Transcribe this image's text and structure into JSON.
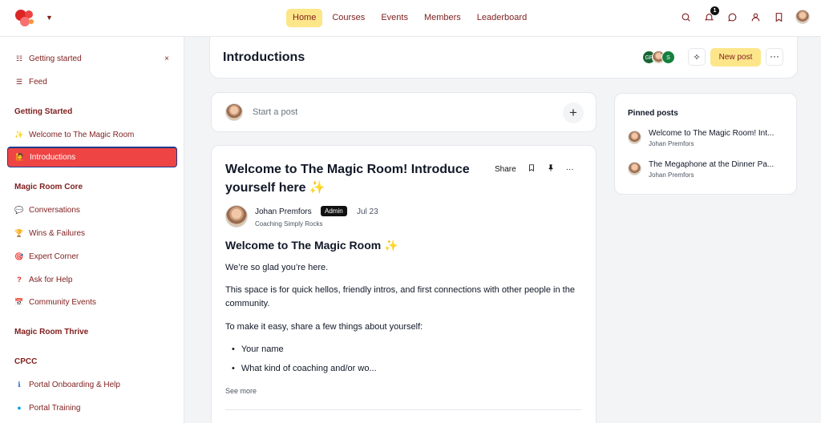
{
  "colors": {
    "accent": "#fde68a",
    "brand": "#7f1d1d",
    "active_sidebar": "#ef4444"
  },
  "nav": {
    "items": [
      "Home",
      "Courses",
      "Events",
      "Members",
      "Leaderboard"
    ],
    "active": "Home"
  },
  "top_icons": {
    "notifications_count": "1"
  },
  "sidebar": {
    "top_items": [
      {
        "label": "Getting started",
        "icon": "checklist-icon"
      },
      {
        "label": "Feed",
        "icon": "list-icon"
      }
    ],
    "sections": [
      {
        "heading": "Getting Started",
        "items": [
          {
            "label": "Welcome to The Magic Room",
            "icon": "✨"
          },
          {
            "label": "Introductions",
            "icon": "🙋",
            "active": true
          }
        ]
      },
      {
        "heading": "Magic Room Core",
        "items": [
          {
            "label": "Conversations",
            "icon": "💬"
          },
          {
            "label": "Wins & Failures",
            "icon": "🏆"
          },
          {
            "label": "Expert Corner",
            "icon": "🎯"
          },
          {
            "label": "Ask for Help",
            "icon": "?"
          },
          {
            "label": "Community Events",
            "icon": "📅"
          }
        ]
      },
      {
        "heading": "Magic Room Thrive",
        "items": []
      },
      {
        "heading": "CPCC",
        "items": [
          {
            "label": "Portal Onboarding & Help",
            "icon": "ℹ"
          },
          {
            "label": "Portal Training",
            "icon": "●"
          }
        ]
      }
    ]
  },
  "header": {
    "title": "Introductions",
    "member_avatars": [
      "GP",
      "",
      "S"
    ],
    "new_post_label": "New post",
    "more_label": "···"
  },
  "composer": {
    "placeholder": "Start a post"
  },
  "post": {
    "title": "Welcome to The Magic Room! Introduce yourself here ✨",
    "actions": {
      "share": "Share"
    },
    "author": {
      "name": "Johan Premfors",
      "role_badge": "Admin",
      "date": "Jul 23",
      "subtitle": "Coaching Simply Rocks"
    },
    "body_heading": "Welcome to The Magic Room ✨",
    "paragraphs": [
      "We’re so glad you’re here.",
      "This space is for quick hellos, friendly intros, and first connections with other people in the community.",
      "To make it easy, share a few things about yourself:"
    ],
    "bullets": [
      "Your name",
      "What kind of coaching and/or wo..."
    ],
    "see_more": "See more"
  },
  "pinned": {
    "title": "Pinned posts",
    "items": [
      {
        "title": "Welcome to The Magic Room! Int...",
        "author": "Johan Premfors"
      },
      {
        "title": "The Megaphone at the Dinner Pa...",
        "author": "Johan Premfors"
      }
    ]
  }
}
